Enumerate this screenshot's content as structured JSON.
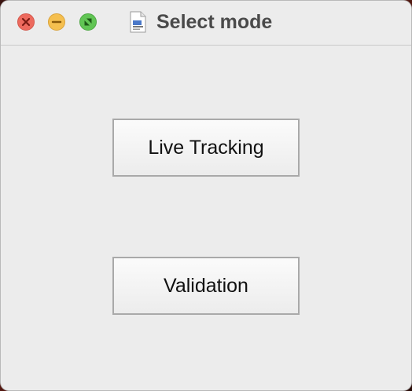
{
  "window": {
    "title": "Select mode",
    "controls": {
      "close": "close-icon",
      "minimize": "minimize-icon",
      "maximize": "fullscreen-icon"
    },
    "app_icon": "document-icon"
  },
  "buttons": {
    "live_tracking": "Live Tracking",
    "validation": "Validation"
  },
  "colors": {
    "close": "#ed6a5e",
    "minimize": "#f5bf4f",
    "maximize": "#61c554",
    "window_bg": "#ececec"
  }
}
